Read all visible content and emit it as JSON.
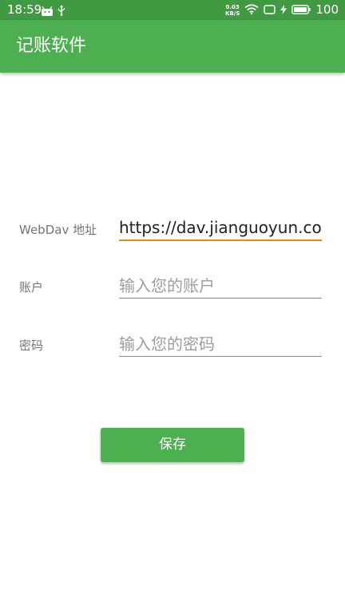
{
  "status_bar": {
    "time": "18:59",
    "net_speed_value": "0.03",
    "net_speed_unit": "KB/S",
    "battery": "100",
    "icons": [
      "android-icon",
      "usb-icon",
      "wifi-icon",
      "sim-icon",
      "charging-icon",
      "battery-icon"
    ]
  },
  "app_bar": {
    "title": "记账软件"
  },
  "form": {
    "webdav": {
      "label": "WebDav 地址",
      "value": "https://dav.jianguoyun.com",
      "placeholder": ""
    },
    "account": {
      "label": "账户",
      "value": "",
      "placeholder": "输入您的账户"
    },
    "password": {
      "label": "密码",
      "value": "",
      "placeholder": "输入您的密码"
    }
  },
  "actions": {
    "save_label": "保存"
  },
  "colors": {
    "primary": "#4caf50",
    "primary_dark": "#3f9a42",
    "accent_underline": "#e8871e"
  }
}
